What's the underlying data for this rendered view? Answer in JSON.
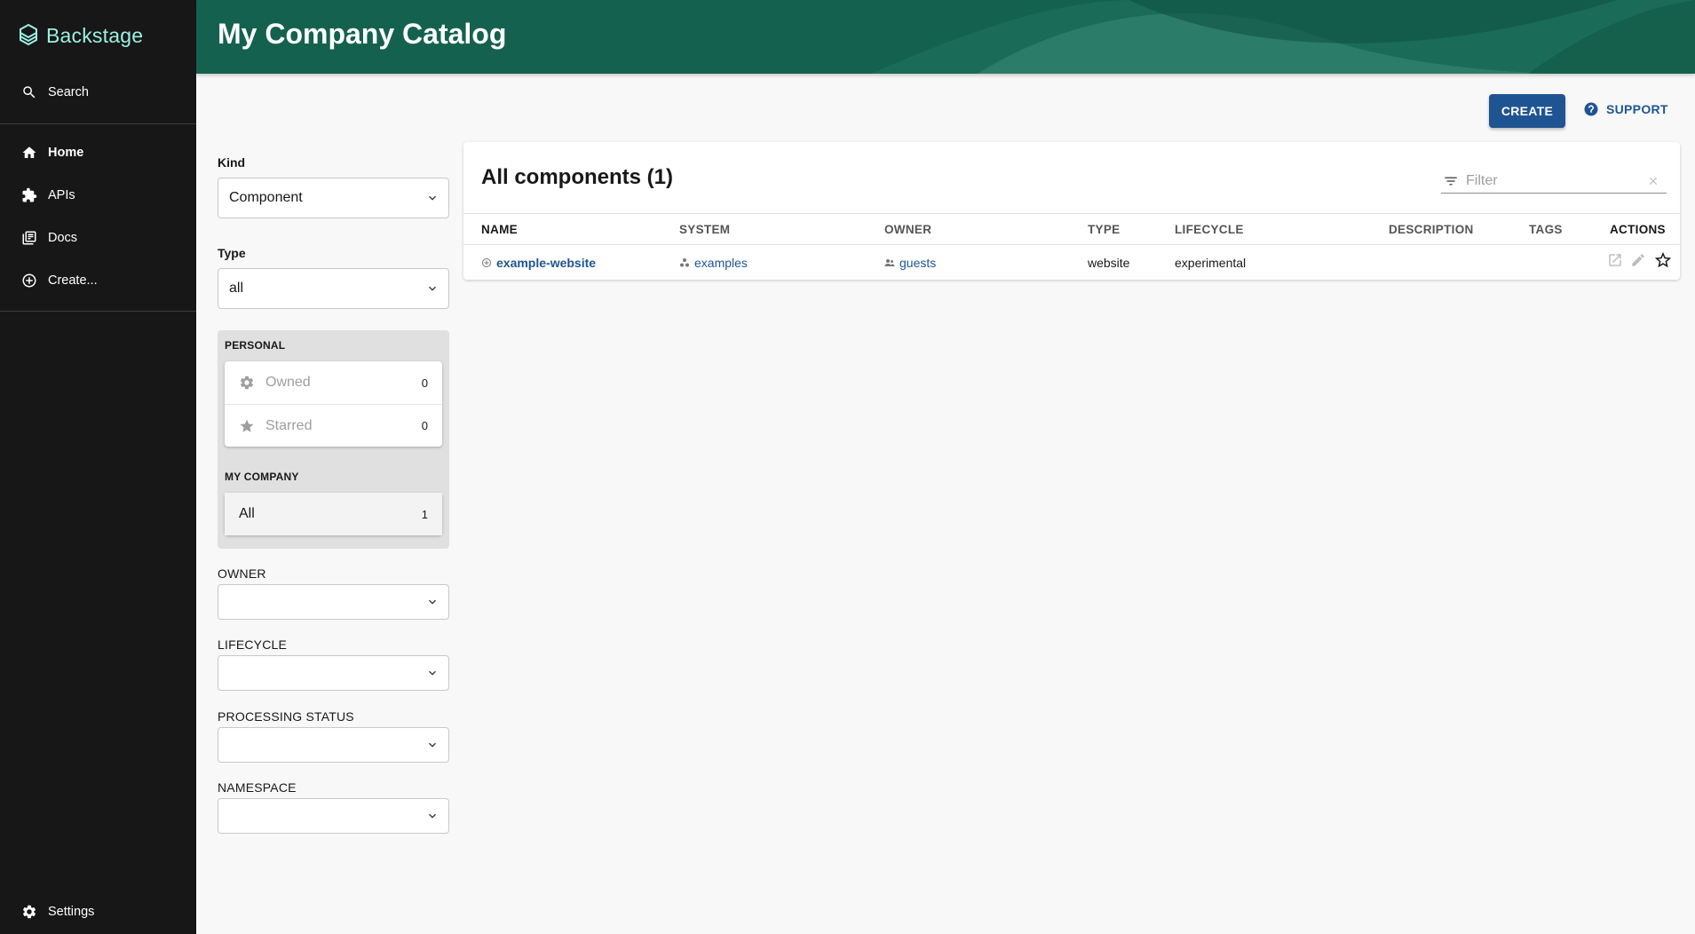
{
  "app": {
    "logo_text": "Backstage"
  },
  "sidebar": {
    "search_label": "Search",
    "items": [
      {
        "label": "Home",
        "icon": "home-icon"
      },
      {
        "label": "APIs",
        "icon": "extension-icon"
      },
      {
        "label": "Docs",
        "icon": "library-books-icon"
      },
      {
        "label": "Create...",
        "icon": "add-circle-outline-icon"
      }
    ],
    "settings_label": "Settings"
  },
  "header": {
    "title": "My Company Catalog"
  },
  "toolbar": {
    "create_label": "CREATE",
    "support_label": "SUPPORT"
  },
  "filters": {
    "kind_label": "Kind",
    "kind_value": "Component",
    "type_label": "Type",
    "type_value": "all",
    "personal_heading": "PERSONAL",
    "owned_label": "Owned",
    "owned_count": "0",
    "starred_label": "Starred",
    "starred_count": "0",
    "company_heading": "MY COMPANY",
    "all_label": "All",
    "all_count": "1",
    "owner_label": "OWNER",
    "lifecycle_label": "LIFECYCLE",
    "processing_status_label": "PROCESSING STATUS",
    "namespace_label": "NAMESPACE"
  },
  "table": {
    "title": "All components (1)",
    "filter_placeholder": "Filter",
    "columns": [
      "NAME",
      "SYSTEM",
      "OWNER",
      "TYPE",
      "LIFECYCLE",
      "DESCRIPTION",
      "TAGS",
      "ACTIONS"
    ],
    "rows": [
      {
        "name": "example-website",
        "system": "examples",
        "owner": "guests",
        "type": "website",
        "lifecycle": "experimental",
        "description": "",
        "tags": ""
      }
    ]
  },
  "colors": {
    "sidebar_bg": "#171717",
    "header_bg": "#15614f",
    "accent": "#1f5493",
    "logo": "#9bf0e1"
  }
}
